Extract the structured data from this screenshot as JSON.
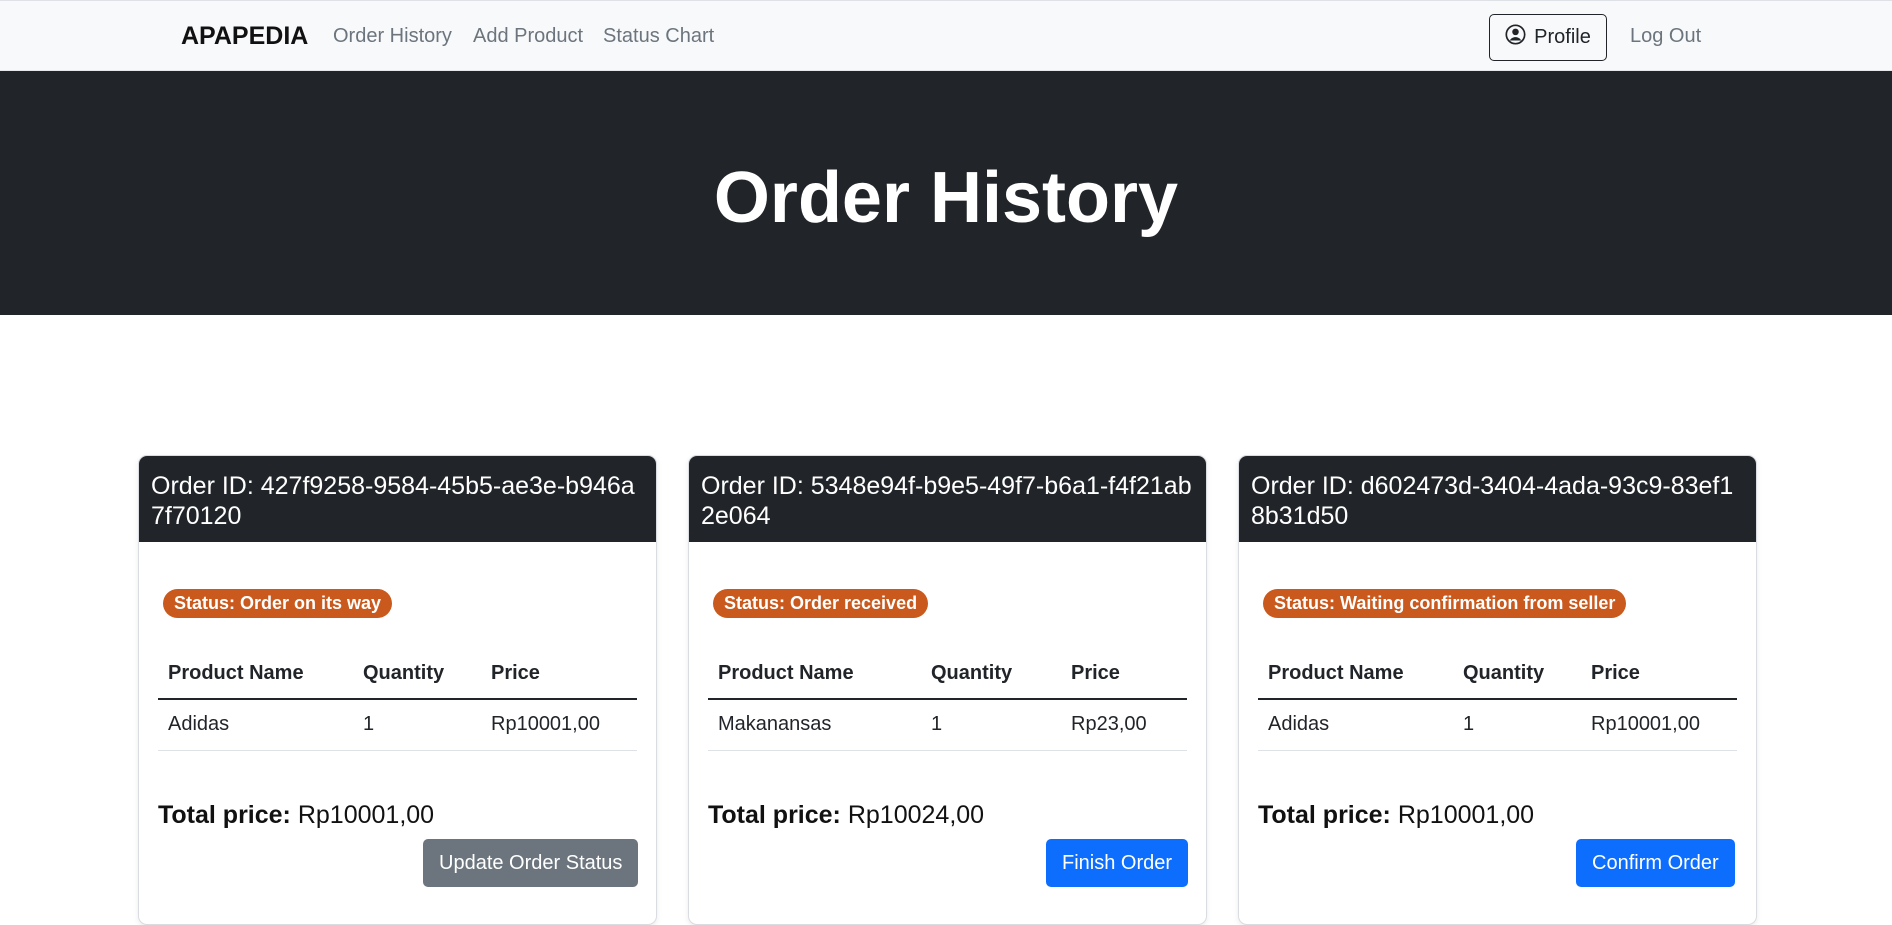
{
  "navbar": {
    "brand": "APAPEDIA",
    "links": [
      "Order History",
      "Add Product",
      "Status Chart"
    ],
    "profile_label": "Profile",
    "profile_icon": "person-circle-icon",
    "logout_label": "Log Out"
  },
  "hero": {
    "title": "Order History"
  },
  "orders": [
    {
      "header": "Order ID: 427f9258-9584-45b5-ae3e-b946a7f70120",
      "status": "Status: Order on its way",
      "columns": [
        "Product Name",
        "Quantity",
        "Price"
      ],
      "rows": [
        [
          "Adidas",
          "1",
          "Rp10001,00"
        ]
      ],
      "total_label": "Total price:",
      "total_value": "Rp10001,00",
      "action": "Update Order Status"
    },
    {
      "header": "Order ID: 5348e94f-b9e5-49f7-b6a1-f4f21ab2e064",
      "status": "Status: Order received",
      "columns": [
        "Product Name",
        "Quantity",
        "Price"
      ],
      "rows": [
        [
          "Makanansas",
          "1",
          "Rp23,00"
        ]
      ],
      "total_label": "Total price:",
      "total_value": "Rp10024,00",
      "action": "Finish Order"
    },
    {
      "header": "Order ID: d602473d-3404-4ada-93c9-83ef18b31d50",
      "status": "Status: Waiting confirmation from seller",
      "columns": [
        "Product Name",
        "Quantity",
        "Price"
      ],
      "rows": [
        [
          "Adidas",
          "1",
          "Rp10001,00"
        ]
      ],
      "total_label": "Total price:",
      "total_value": "Rp10001,00",
      "action": "Confirm Order"
    }
  ],
  "colors": {
    "dark": "#212529",
    "badge": "#c9591c",
    "primary": "#0d6efd",
    "secondary": "#6c757d"
  }
}
